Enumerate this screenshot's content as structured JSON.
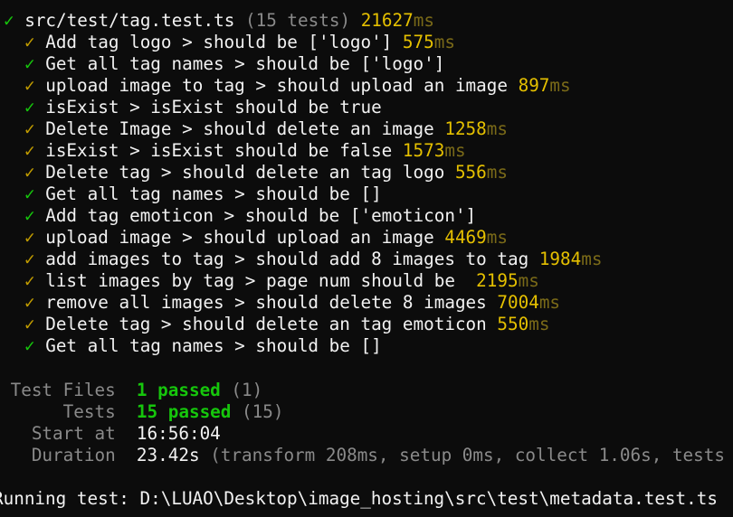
{
  "file_header": {
    "check": "✓",
    "path": "src/test/tag.test.ts",
    "count": "(15 tests)",
    "duration": "21627",
    "unit": "ms"
  },
  "tests": [
    {
      "check": "✓",
      "name": "Add tag logo > should be ['logo']",
      "time": "575",
      "unit": "ms",
      "slow": true
    },
    {
      "check": "✓",
      "name": "Get all tag names > should be ['logo']",
      "time": "",
      "unit": "",
      "slow": false
    },
    {
      "check": "✓",
      "name": "upload image to tag > should upload an image",
      "time": "897",
      "unit": "ms",
      "slow": true
    },
    {
      "check": "✓",
      "name": "isExist > isExist should be true",
      "time": "",
      "unit": "",
      "slow": false
    },
    {
      "check": "✓",
      "name": "Delete Image > should delete an image",
      "time": "1258",
      "unit": "ms",
      "slow": true
    },
    {
      "check": "✓",
      "name": "isExist > isExist should be false",
      "time": "1573",
      "unit": "ms",
      "slow": true
    },
    {
      "check": "✓",
      "name": "Delete tag > should delete an tag logo",
      "time": "556",
      "unit": "ms",
      "slow": true
    },
    {
      "check": "✓",
      "name": "Get all tag names > should be []",
      "time": "",
      "unit": "",
      "slow": false
    },
    {
      "check": "✓",
      "name": "Add tag emoticon > should be ['emoticon']",
      "time": "",
      "unit": "",
      "slow": false
    },
    {
      "check": "✓",
      "name": "upload image > should upload an image",
      "time": "4469",
      "unit": "ms",
      "slow": true
    },
    {
      "check": "✓",
      "name": "add images to tag > should add 8 images to tag",
      "time": "1984",
      "unit": "ms",
      "slow": true
    },
    {
      "check": "✓",
      "name": "list images by tag > page num should be ",
      "time": "2195",
      "unit": "ms",
      "slow": true
    },
    {
      "check": "✓",
      "name": "remove all images > should delete 8 images",
      "time": "7004",
      "unit": "ms",
      "slow": true
    },
    {
      "check": "✓",
      "name": "Delete tag > should delete an tag emoticon",
      "time": "550",
      "unit": "ms",
      "slow": true
    },
    {
      "check": "✓",
      "name": "Get all tag names > should be []",
      "time": "",
      "unit": "",
      "slow": false
    }
  ],
  "summary": {
    "test_files_label": " Test Files",
    "test_files_passed": "1 passed",
    "test_files_total": "(1)",
    "tests_label": "      Tests",
    "tests_passed": "15 passed",
    "tests_total": "(15)",
    "start_label": "   Start at",
    "start_value": "16:56:04",
    "duration_label": "   Duration",
    "duration_value": "23.42s",
    "duration_detail": "(transform 208ms, setup 0ms, collect 1.06s, tests"
  },
  "status_line": "Running test: D:\\LUAO\\Desktop\\image_hosting\\src\\test\\metadata.test.ts",
  "colors": {
    "background": "#0c0c0c",
    "pass_green": "#16c60c",
    "slow_gold": "#c19c00",
    "text": "#cccccc",
    "muted": "#8a8a8a"
  }
}
